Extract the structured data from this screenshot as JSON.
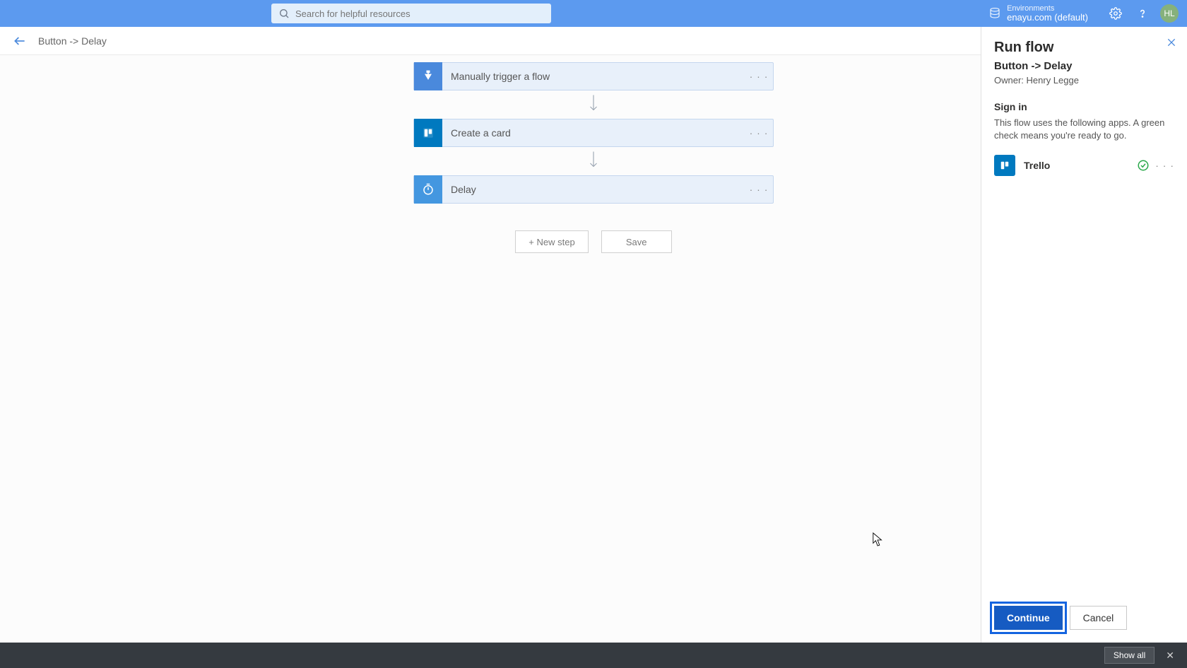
{
  "header": {
    "search_placeholder": "Search for helpful resources",
    "env_label": "Environments",
    "env_name": "enayu.com (default)",
    "avatar_initials": "HL"
  },
  "breadcrumb": "Button -> Delay",
  "flow": {
    "steps": [
      {
        "label": "Manually trigger a flow",
        "icon": "trigger"
      },
      {
        "label": "Create a card",
        "icon": "trello"
      },
      {
        "label": "Delay",
        "icon": "delay"
      }
    ],
    "new_step_label": "+ New step",
    "save_label": "Save"
  },
  "panel": {
    "title": "Run flow",
    "subtitle": "Button -> Delay",
    "owner_label": "Owner: Henry Legge",
    "signin_heading": "Sign in",
    "signin_desc": "This flow uses the following apps. A green check means you're ready to go.",
    "connections": [
      {
        "name": "Trello",
        "status": "ok"
      }
    ],
    "continue_label": "Continue",
    "cancel_label": "Cancel"
  },
  "bottom_bar": {
    "show_all_label": "Show all"
  }
}
